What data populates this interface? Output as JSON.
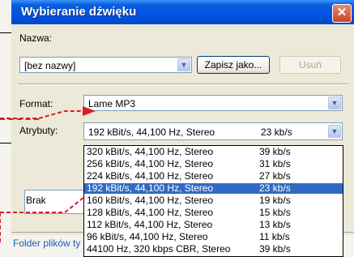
{
  "dialog": {
    "title": "Wybieranie dźwięku",
    "close_glyph": "✕"
  },
  "name_section": {
    "label": "Nazwa:",
    "value": "[bez nazwy]",
    "save_as_button": "Zapisz jako...",
    "delete_button": "Usuń"
  },
  "format": {
    "label": "Format:",
    "value": "Lame MP3"
  },
  "attributes": {
    "label": "Atrybuty:",
    "value": "192 kBit/s, 44,100 Hz, Stereo",
    "rate": "23 kb/s",
    "options": [
      {
        "text": "320 kBit/s, 44,100 Hz, Stereo",
        "rate": "39 kb/s",
        "selected": false
      },
      {
        "text": "256 kBit/s, 44,100 Hz, Stereo",
        "rate": "31 kb/s",
        "selected": false
      },
      {
        "text": "224 kBit/s, 44,100 Hz, Stereo",
        "rate": "27 kb/s",
        "selected": false
      },
      {
        "text": "192 kBit/s, 44,100 Hz, Stereo",
        "rate": "23 kb/s",
        "selected": true
      },
      {
        "text": "160 kBit/s, 44,100 Hz, Stereo",
        "rate": "19 kb/s",
        "selected": false
      },
      {
        "text": "128 kBit/s, 44,100 Hz, Stereo",
        "rate": "15 kb/s",
        "selected": false
      },
      {
        "text": "112 kBit/s, 44,100 Hz, Stereo",
        "rate": "13 kb/s",
        "selected": false
      },
      {
        "text": "96 kBit/s, 44,100 Hz, Stereo",
        "rate": "11 kb/s",
        "selected": false
      },
      {
        "text": "44100 Hz, 320 kbps CBR, Stereo",
        "rate": "39 kb/s",
        "selected": false
      }
    ]
  },
  "background": {
    "brak_label": "Brak",
    "folder_link": "Folder plików ty"
  },
  "colors": {
    "accent": "#d81f26",
    "titlebar": "#0055e5",
    "selection": "#316ac5"
  }
}
